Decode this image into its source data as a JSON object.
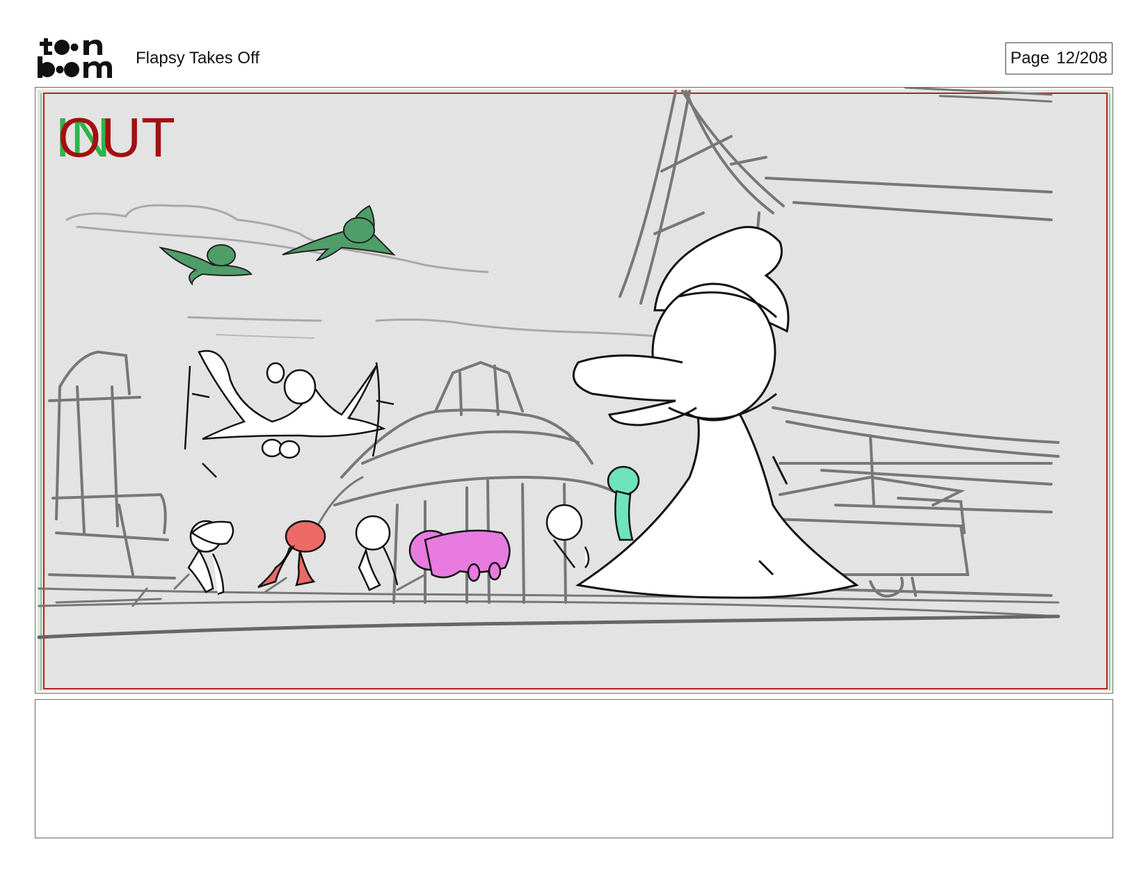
{
  "header": {
    "brand_top": "to n",
    "brand_bottom": "b  m",
    "project_title": "Flapsy Takes Off",
    "page_label": "Page",
    "page_number": "12/208"
  },
  "panel": {
    "in_marker": "IN",
    "out_marker": "OUT",
    "in_color": "#2fb34a",
    "out_color": "#a30f0f",
    "safe_frame_color": "#b22222",
    "background_color": "#e3e3e3",
    "character_colors": {
      "flying_birds": "#4f9d69",
      "red_character": "#ec6a66",
      "pink_character": "#e77bdf",
      "teal_character": "#6fe3b9"
    }
  },
  "caption": {
    "text": ""
  }
}
